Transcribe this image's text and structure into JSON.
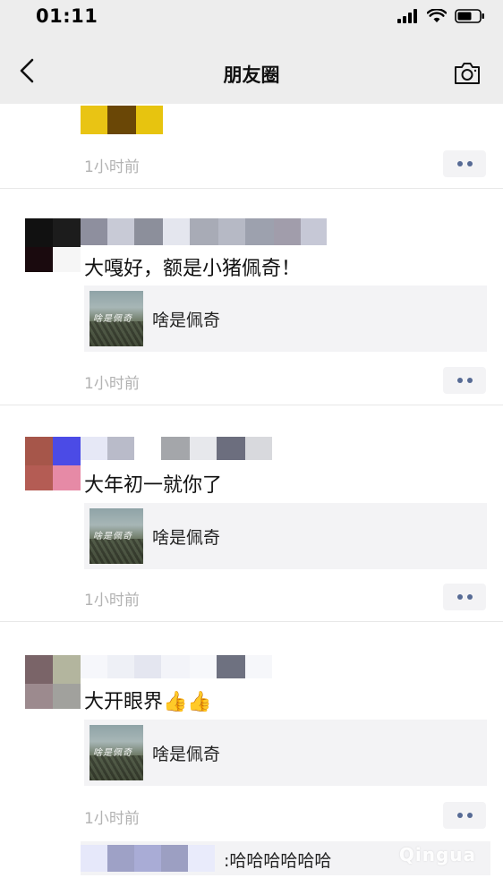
{
  "status_bar": {
    "time": "01:11",
    "icons": [
      "signal-icon",
      "wifi-icon",
      "battery-icon"
    ]
  },
  "nav": {
    "back_icon": "chevron-left-icon",
    "title": "朋友圈",
    "camera_icon": "camera-icon"
  },
  "posts": [
    {
      "time": "1小时前"
    },
    {
      "text": "大嘎好，额是小猪佩奇！",
      "link_card": {
        "title": "啥是佩奇",
        "thumb_overlay": "啥是佩奇"
      },
      "time": "1小时前"
    },
    {
      "text": "大年初一就你了",
      "link_card": {
        "title": "啥是佩奇",
        "thumb_overlay": "啥是佩奇"
      },
      "time": "1小时前"
    },
    {
      "text": "大开眼界👍👍",
      "link_card": {
        "title": "啥是佩奇",
        "thumb_overlay": "啥是佩奇"
      },
      "time": "1小时前",
      "comment": ":哈哈哈哈哈哈"
    }
  ],
  "watermark": "Qingua",
  "colors": {
    "nav_bg": "#ededed",
    "card_bg": "#f3f3f5",
    "link_blue": "#576b95",
    "time_gray": "#b2b2b2"
  }
}
